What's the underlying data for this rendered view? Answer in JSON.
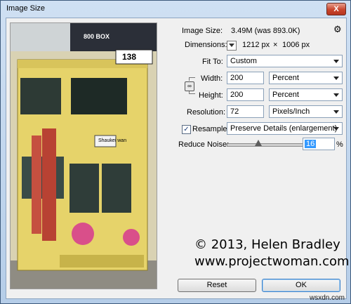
{
  "window": {
    "title": "Image Size",
    "close_label": "X"
  },
  "preview": {
    "tram_number": "138",
    "billboard_text": "800 BOX",
    "tram_text": "Shaukei wan"
  },
  "image_size": {
    "label": "Image Size:",
    "value": "3.49M (was 893.0K)"
  },
  "dimensions": {
    "label": "Dimensions:",
    "width": "1212 px",
    "times": "×",
    "height": "1006 px"
  },
  "fit_to": {
    "label": "Fit To:",
    "value": "Custom"
  },
  "width": {
    "label": "Width:",
    "value": "200",
    "unit": "Percent"
  },
  "height": {
    "label": "Height:",
    "value": "200",
    "unit": "Percent"
  },
  "resolution": {
    "label": "Resolution:",
    "value": "72",
    "unit": "Pixels/Inch"
  },
  "resample": {
    "label": "Resample:",
    "checked": true,
    "check_mark": "✓",
    "method": "Preserve Details (enlargement)"
  },
  "reduce_noise": {
    "label": "Reduce Noise:",
    "value": "16",
    "unit": "%",
    "slider_level": 16
  },
  "watermark": {
    "line1": "© 2013, Helen Bradley",
    "line2": "www.projectwoman.com"
  },
  "buttons": {
    "reset": "Reset",
    "ok": "OK"
  },
  "footer": "wsxdn.com"
}
